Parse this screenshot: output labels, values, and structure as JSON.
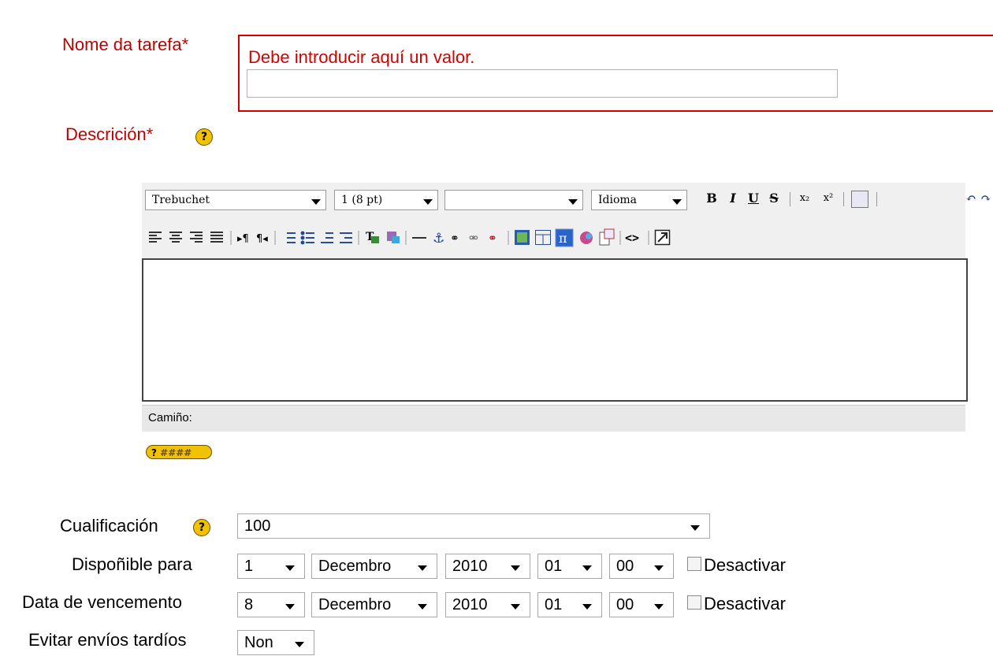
{
  "fields": {
    "task_name": {
      "label": "Nome da tarefa*",
      "error": "Debe introducir aquí un valor.",
      "value": ""
    },
    "description": {
      "label": "Descrición*",
      "help_icon": "question-mark-icon"
    }
  },
  "editor": {
    "font_family": "Trebuchet",
    "font_size": "1 (8 pt)",
    "format": "",
    "language": "Idioma",
    "row1_buttons": [
      "B",
      "I",
      "U",
      "S",
      "x₂",
      "x²",
      "paste-word-icon",
      "undo-icon",
      "redo-icon"
    ],
    "row2_buttons": [
      "align-left-icon",
      "align-center-icon",
      "align-right-icon",
      "justify-icon",
      "ltr-icon",
      "rtl-icon",
      "ordered-list-icon",
      "unordered-list-icon",
      "outdent-icon",
      "indent-icon",
      "text-color-icon",
      "bg-color-icon",
      "hr-icon",
      "anchor-icon",
      "link-icon",
      "unlink-icon",
      "nolink-icon",
      "image-icon",
      "table-icon",
      "pi-icon",
      "smiley-icon",
      "search-replace-icon",
      "html-source-icon",
      "fullscreen-icon"
    ],
    "path_label": "Camiño:",
    "help_icon": "editor-help-icon"
  },
  "grade": {
    "label": "Cualificación",
    "value": "100"
  },
  "available": {
    "label": "Dispoñible para",
    "day": "1",
    "month": "Decembro",
    "year": "2010",
    "hour": "01",
    "minute": "00",
    "disable_label": "Desactivar"
  },
  "due": {
    "label": "Data de vencemento",
    "day": "8",
    "month": "Decembro",
    "year": "2010",
    "hour": "01",
    "minute": "00",
    "disable_label": "Desactivar"
  },
  "late": {
    "label": "Evitar envíos tardíos",
    "value": "Non"
  }
}
